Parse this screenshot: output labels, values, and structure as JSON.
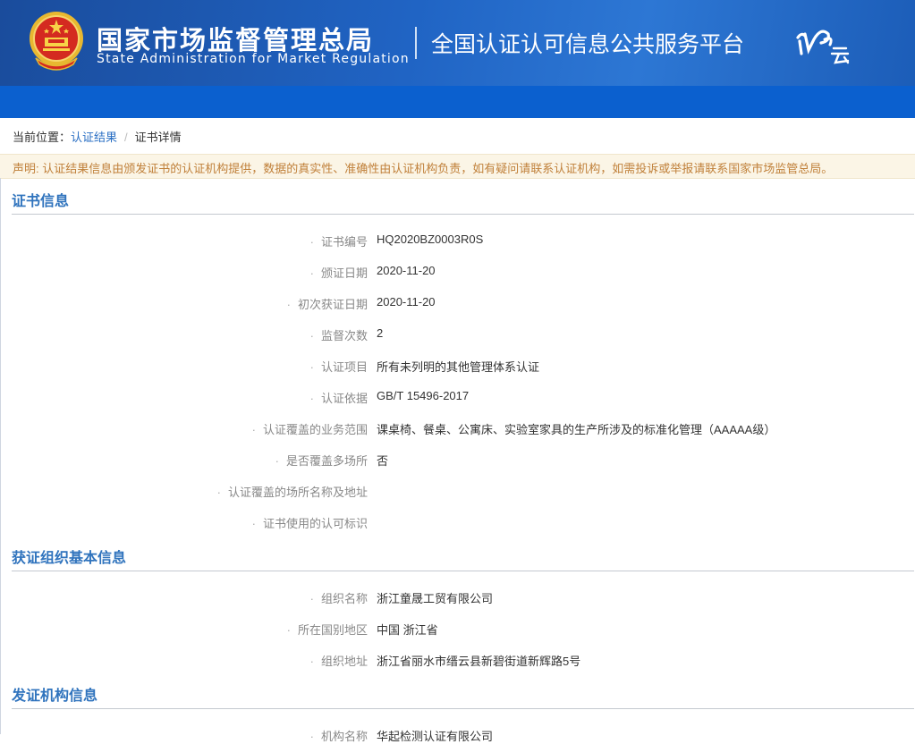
{
  "header": {
    "agency_cn": "国家市场监督管理总局",
    "agency_en": "State Administration for Market Regulation",
    "platform_title": "全国认证认可信息公共服务平台",
    "brand_color": "#1b62bf",
    "logo_icon": "renzheng-yun-logo",
    "emblem_icon": "national-emblem-icon"
  },
  "breadcrumb": {
    "prefix": "当前位置：",
    "link": "认证结果",
    "separator": "/",
    "current": "证书详情"
  },
  "notice": "声明: 认证结果信息由颁发证书的认证机构提供，数据的真实性、准确性由认证机构负责，如有疑问请联系认证机构，如需投诉或举报请联系国家市场监管总局。",
  "sections": [
    {
      "title": "证书信息",
      "rows": [
        {
          "label": "证书编号",
          "value": "HQ2020BZ0003R0S"
        },
        {
          "label": "颁证日期",
          "value": "2020-11-20"
        },
        {
          "label": "初次获证日期",
          "value": "2020-11-20"
        },
        {
          "label": "监督次数",
          "value": "2"
        },
        {
          "label": "认证项目",
          "value": "所有未列明的其他管理体系认证"
        },
        {
          "label": "认证依据",
          "value": "GB/T 15496-2017"
        },
        {
          "label": "认证覆盖的业务范围",
          "value": "课桌椅、餐桌、公寓床、实验室家具的生产所涉及的标准化管理（AAAAA级）"
        },
        {
          "label": "是否覆盖多场所",
          "value": "否"
        },
        {
          "label": "认证覆盖的场所名称及地址",
          "value": ""
        },
        {
          "label": "证书使用的认可标识",
          "value": ""
        }
      ]
    },
    {
      "title": "获证组织基本信息",
      "rows": [
        {
          "label": "组织名称",
          "value": "浙江童晟工贸有限公司"
        },
        {
          "label": "所在国别地区",
          "value": "中国 浙江省"
        },
        {
          "label": "组织地址",
          "value": "浙江省丽水市缙云县新碧街道新辉路5号"
        }
      ]
    },
    {
      "title": "发证机构信息",
      "rows": [
        {
          "label": "机构名称",
          "value": "华起检测认证有限公司"
        }
      ]
    }
  ]
}
